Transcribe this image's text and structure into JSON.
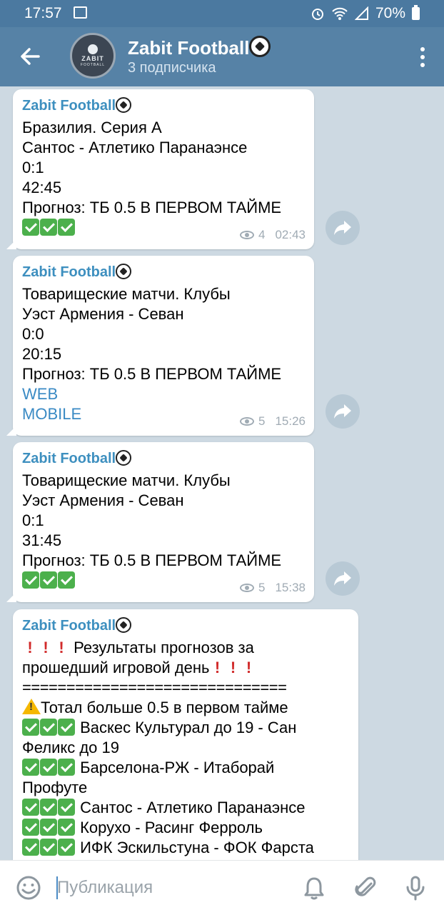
{
  "status_bar": {
    "time": "17:57",
    "battery": "70%"
  },
  "header": {
    "title": "Zabit Football",
    "subtitle": "3 подписчика",
    "avatar_name": "ZABIT",
    "avatar_sub": "FOOTBALL"
  },
  "messages": [
    {
      "author": "Zabit Football",
      "lines": [
        "Бразилия. Серия А",
        "Сантос - Атлетико Паранаэнсе",
        "0:1",
        "42:45",
        "Прогноз: ТБ 0.5 В ПЕРВОМ ТАЙМЕ"
      ],
      "views": "4",
      "time": "02:43"
    },
    {
      "author": "Zabit Football",
      "lines": [
        "Товарищеские матчи. Клубы",
        "Уэст Армения - Севан",
        "0:0",
        "20:15",
        "Прогноз: ТБ 0.5 В ПЕРВОМ ТАЙМЕ"
      ],
      "links": [
        "WEB",
        "MOBILE"
      ],
      "views": "5",
      "time": "15:26"
    },
    {
      "author": "Zabit Football",
      "lines": [
        "Товарищеские матчи. Клубы",
        "Уэст Армения - Севан",
        "0:1",
        "31:45",
        "Прогноз: ТБ 0.5 В ПЕРВОМ ТАЙМЕ"
      ],
      "views": "5",
      "time": "15:38"
    },
    {
      "author": "Zabit Football",
      "headline_1": " Результаты прогнозов за",
      "headline_2": "прошедший игровой день",
      "separator": "==============================",
      "category": "Тотал больше 0.5 в первом тайме",
      "results": [
        " Васкес Культурал до 19 - Сан",
        "Феликс до 19",
        " Барселона-РЖ - Итаборай",
        "Профуте",
        " Сантос - Атлетико Паранаэнсе",
        " Корухо - Расинг Ферроль",
        " ИФК Эскильстуна - ФОК Фарста"
      ]
    }
  ],
  "input": {
    "placeholder": "Публикация"
  },
  "colors": {
    "header": "#5682a6",
    "status_bar": "#4b79a0",
    "author": "#3d8fbf",
    "check": "#4cb04c"
  }
}
